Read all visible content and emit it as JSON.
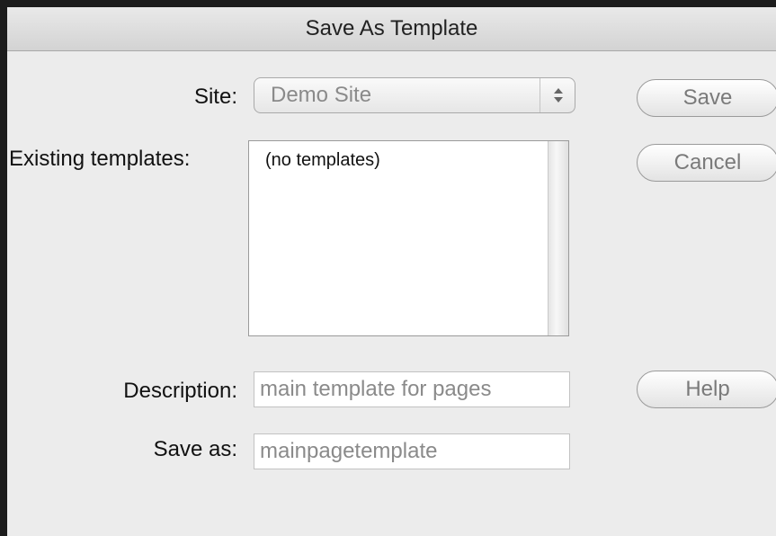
{
  "dialog": {
    "title": "Save As Template"
  },
  "site": {
    "label": "Site:",
    "selected": "Demo Site"
  },
  "existing_templates": {
    "label": "Existing templates:",
    "items": [
      "(no templates)"
    ]
  },
  "description": {
    "label": "Description:",
    "value": "main template for pages"
  },
  "save_as": {
    "label": "Save as:",
    "value": "mainpagetemplate"
  },
  "buttons": {
    "save": "Save",
    "cancel": "Cancel",
    "help": "Help"
  },
  "icons": {
    "site_select": "up-down-chevron-icon"
  }
}
